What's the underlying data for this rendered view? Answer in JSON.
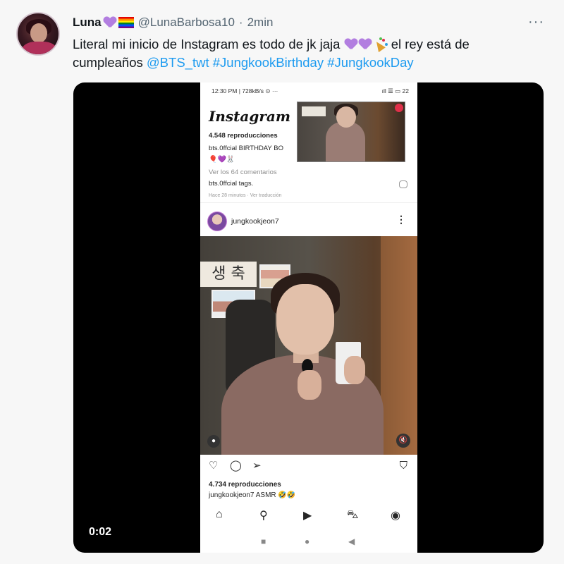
{
  "tweet": {
    "display_name": "Luna",
    "handle": "@LunaBarbosa10",
    "separator": "·",
    "time": "2min",
    "more": "···",
    "text_part1": "Literal mi inicio de Instagram es todo de jk jaja",
    "text_part2": "el rey está de cumpleaños",
    "mention": "@BTS_twt",
    "hashtag1": "#JungkookBirthday",
    "hashtag2": "#JungkookDay"
  },
  "video": {
    "elapsed": "0:02"
  },
  "phone": {
    "status_left": "12:30 PM | 728kB/s ⊙ ···",
    "status_right": "ıll ☰ ▭ 22",
    "app_logo": "Instagram",
    "post1_views": "4.548 reproducciones",
    "post1_caption_user": "bts.0ffcial",
    "post1_caption": "BIRTHDAY BO",
    "post1_emojis": "🎈💜🐰",
    "post1_comments": "Ver los 64 comentarios",
    "post1_tag_user": "bts.0ffcial",
    "post1_tag_text": "tags.",
    "post1_meta": "Hace 28 minutos · Ver traducción",
    "post2_user": "jungkookjeon7",
    "post2_more": "⋮",
    "photo_sign": "생 축",
    "photo_left_badge": "●",
    "photo_mute": "🔇",
    "post2_views": "4.734 reproducciones",
    "post2_caption_user": "jungkookjeon7",
    "post2_caption": "ASMR 🤣🤣",
    "icons": {
      "like": "♡",
      "comment": "◯",
      "share": "➢",
      "save": "⛉",
      "home": "⌂",
      "search": "⚲",
      "reels": "▶",
      "shop": "⛍",
      "profile": "◉",
      "sys_recent": "■",
      "sys_home": "●",
      "sys_back": "◀"
    }
  },
  "colors": {
    "link": "#1d9bf0",
    "text": "#0f1419",
    "muted": "#536471",
    "background": "#f7f7f7"
  }
}
